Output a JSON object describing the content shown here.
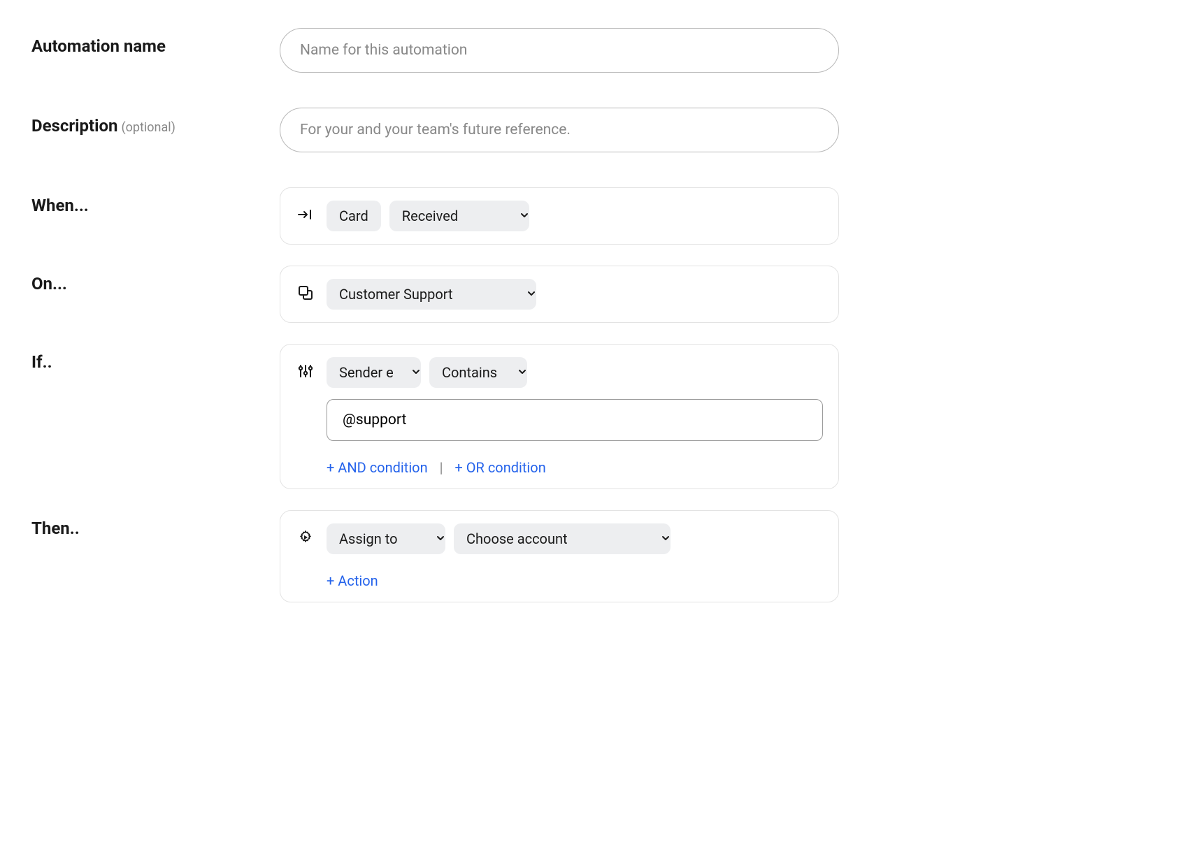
{
  "labels": {
    "automation_name": "Automation name",
    "description": "Description",
    "optional": "(optional)",
    "when": "When...",
    "on": "On...",
    "if": "If..",
    "then": "Then.."
  },
  "inputs": {
    "name_placeholder": "Name for this automation",
    "description_placeholder": "For your and your team's future reference."
  },
  "when": {
    "entity": "Card",
    "event": "Received"
  },
  "on": {
    "target": "Customer Support"
  },
  "if": {
    "field": "Sender e",
    "operator": "Contains",
    "value": "@support",
    "add_and": "+ AND condition",
    "add_or": "+ OR condition"
  },
  "then": {
    "action": "Assign to",
    "target": "Choose account",
    "add_action": "+ Action"
  }
}
